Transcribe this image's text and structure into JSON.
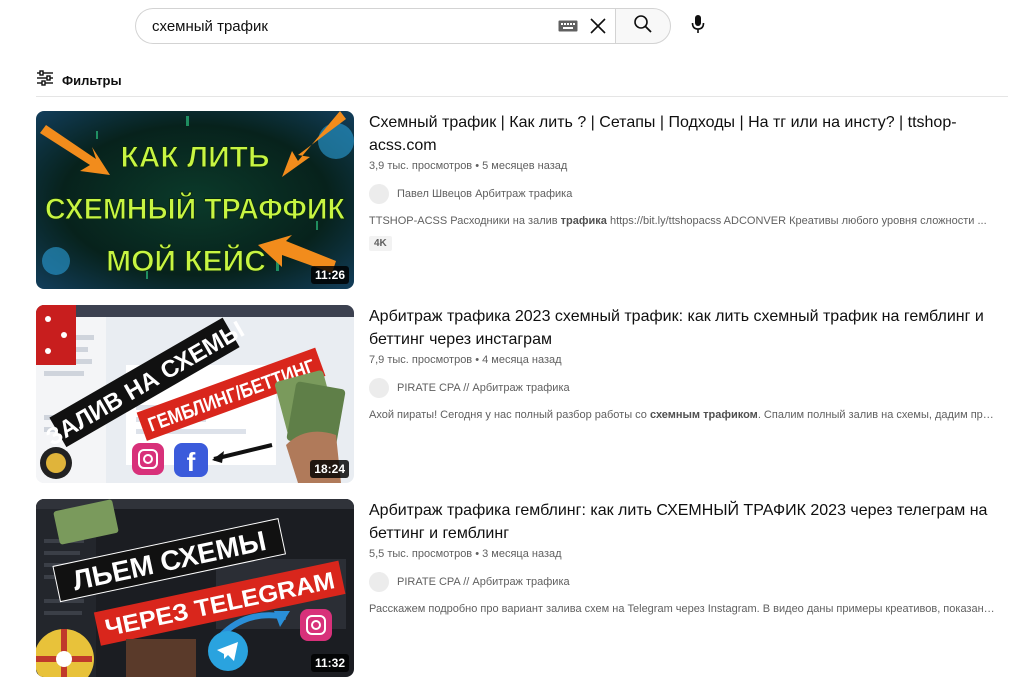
{
  "search": {
    "query": "схемный трафик"
  },
  "filters": {
    "label": "Фильтры"
  },
  "results": [
    {
      "title": "Схемный трафик | Как лить ? | Сетапы | Подходы | На тг или на инсту? | ttshop-acss.com",
      "views": "3,9 тыс. просмотров",
      "age": "5 месяцев назад",
      "channel": "Павел Швецов Арбитраж трафика",
      "desc_before": "TTSHOP-ACSS Расходники на залив ",
      "desc_bold": "трафика",
      "desc_after": " https://bit.ly/ttshopacss ADCONVER Креативы любого уровня сложности ...",
      "badge": "4K",
      "duration": "11:26",
      "thumb_lines": [
        "КАК ЛИТЬ",
        "СХЕМНЫЙ ТРАФФИК",
        "МОЙ КЕЙС"
      ]
    },
    {
      "title": "Арбитраж трафика 2023 схемный трафик: как лить схемный трафик на гемблинг и беттинг через инстаграм",
      "views": "7,9 тыс. просмотров",
      "age": "4 месяца назад",
      "channel": "PIRATE CPA // Арбитраж трафика",
      "desc_before": "Ахой пираты! Сегодня у нас полный разбор работы со ",
      "desc_bold": "схемным трафиком",
      "desc_after": ". Спалим полный залив на схемы, дадим пример ...",
      "badge": "",
      "duration": "18:24",
      "thumb_lines": [
        "ЗАЛИВ НА СХЕМЫ",
        "ГЕМБЛИНГ/БЕТТИНГ"
      ]
    },
    {
      "title": "Арбитраж трафика гемблинг: как лить СХЕМНЫЙ ТРАФИК 2023 через телеграм на беттинг и гемблинг",
      "views": "5,5 тыс. просмотров",
      "age": "3 месяца назад",
      "channel": "PIRATE CPA // Арбитраж трафика",
      "desc_before": "Расскажем подробно про вариант залива схем на Telegram через Instagram. В видео даны примеры креативов, показана ...",
      "desc_bold": "",
      "desc_after": "",
      "badge": "",
      "duration": "11:32",
      "thumb_lines": [
        "ЛЬЕМ СХЕМЫ",
        "ЧЕРЕЗ TELEGRAM"
      ]
    }
  ]
}
